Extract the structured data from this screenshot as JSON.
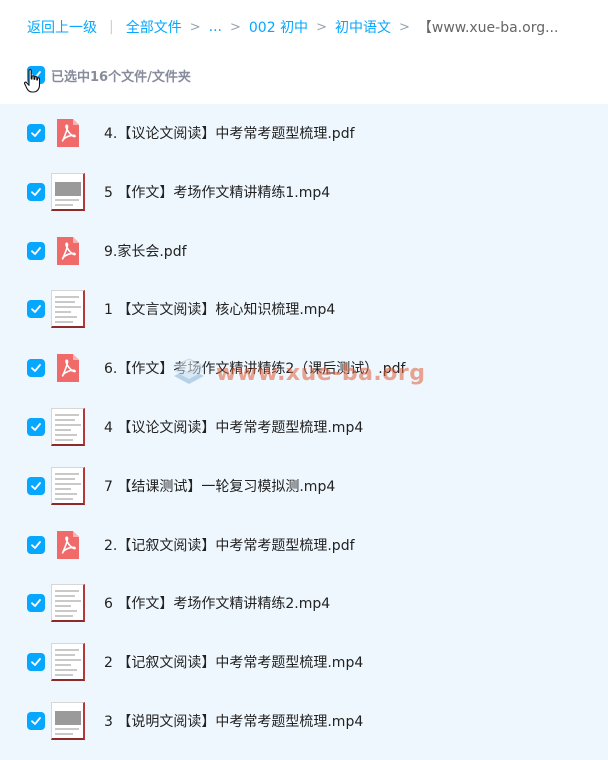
{
  "breadcrumb": {
    "back": "返回上一级",
    "all_files": "全部文件",
    "ellipsis": "...",
    "level1": "002 初中",
    "level2": "初中语文",
    "current": "【www.xue-ba.org..."
  },
  "selection": {
    "label": "已选中16个文件/文件夹",
    "checked": true
  },
  "files": [
    {
      "name": "4.【议论文阅读】中考常考题型梳理.pdf",
      "type": "pdf",
      "checked": true
    },
    {
      "name": "5 【作文】考场作文精讲精练1.mp4",
      "type": "video",
      "checked": true
    },
    {
      "name": "9.家长会.pdf",
      "type": "pdf",
      "checked": true
    },
    {
      "name": "1 【文言文阅读】核心知识梳理.mp4",
      "type": "video",
      "checked": true
    },
    {
      "name": "6.【作文】考场作文精讲精练2（课后测试）.pdf",
      "type": "pdf",
      "checked": true
    },
    {
      "name": "4 【议论文阅读】中考常考题型梳理.mp4",
      "type": "video",
      "checked": true
    },
    {
      "name": "7 【结课测试】一轮复习模拟测.mp4",
      "type": "video",
      "checked": true
    },
    {
      "name": "2.【记叙文阅读】中考常考题型梳理.pdf",
      "type": "pdf",
      "checked": true
    },
    {
      "name": "6 【作文】考场作文精讲精练2.mp4",
      "type": "video",
      "checked": true
    },
    {
      "name": "2 【记叙文阅读】中考常考题型梳理.mp4",
      "type": "video",
      "checked": true
    },
    {
      "name": "3 【说明文阅读】中考常考题型梳理.mp4",
      "type": "video",
      "checked": true
    }
  ],
  "watermark": {
    "text": "www.xue-ba.org"
  },
  "colors": {
    "accent": "#06a7ff",
    "list_bg": "#eef7fd",
    "pdf": "#f06a6a"
  }
}
